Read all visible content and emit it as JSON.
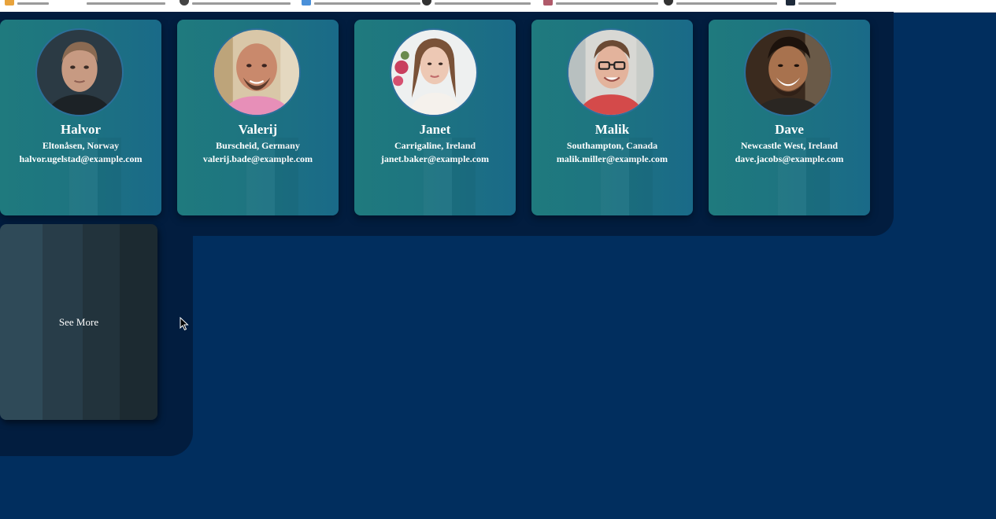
{
  "browser": {
    "bookmarks": [
      {
        "icon": "apps-icon",
        "color": "#e8a33c"
      },
      {
        "icon": "github-icon",
        "color": "#333333"
      },
      {
        "icon": "google-icon",
        "color": "#555555"
      },
      {
        "icon": "doc-icon",
        "color": "#4a90d9"
      },
      {
        "icon": "github-icon",
        "color": "#333333"
      },
      {
        "icon": "image-icon",
        "color": "#b05a6a"
      },
      {
        "icon": "github-icon",
        "color": "#333333"
      },
      {
        "icon": "terminal-icon",
        "color": "#1e2a3a"
      }
    ]
  },
  "users": [
    {
      "name": "Halvor",
      "location": "Eltonåsen, Norway",
      "email": "halvor.ugelstad@example.com",
      "avatar": "man-portrait-dark"
    },
    {
      "name": "Valerij",
      "location": "Burscheid, Germany",
      "email": "valerij.bade@example.com",
      "avatar": "bald-man-portrait"
    },
    {
      "name": "Janet",
      "location": "Carrigaline, Ireland",
      "email": "janet.baker@example.com",
      "avatar": "woman-portrait"
    },
    {
      "name": "Malik",
      "location": "Southampton, Canada",
      "email": "malik.miller@example.com",
      "avatar": "man-glasses-portrait"
    },
    {
      "name": "Dave",
      "location": "Newcastle West, Ireland",
      "email": "dave.jacobs@example.com",
      "avatar": "smiling-man-portrait"
    }
  ],
  "see_more": {
    "label": "See More"
  },
  "colors": {
    "page_background": "#012e5e",
    "card_teal": "#1e7580",
    "card_blue": "#1a6a88",
    "see_more_stripes": [
      "#2f4a58",
      "#283d49",
      "#22333c",
      "#1c2a31"
    ]
  }
}
